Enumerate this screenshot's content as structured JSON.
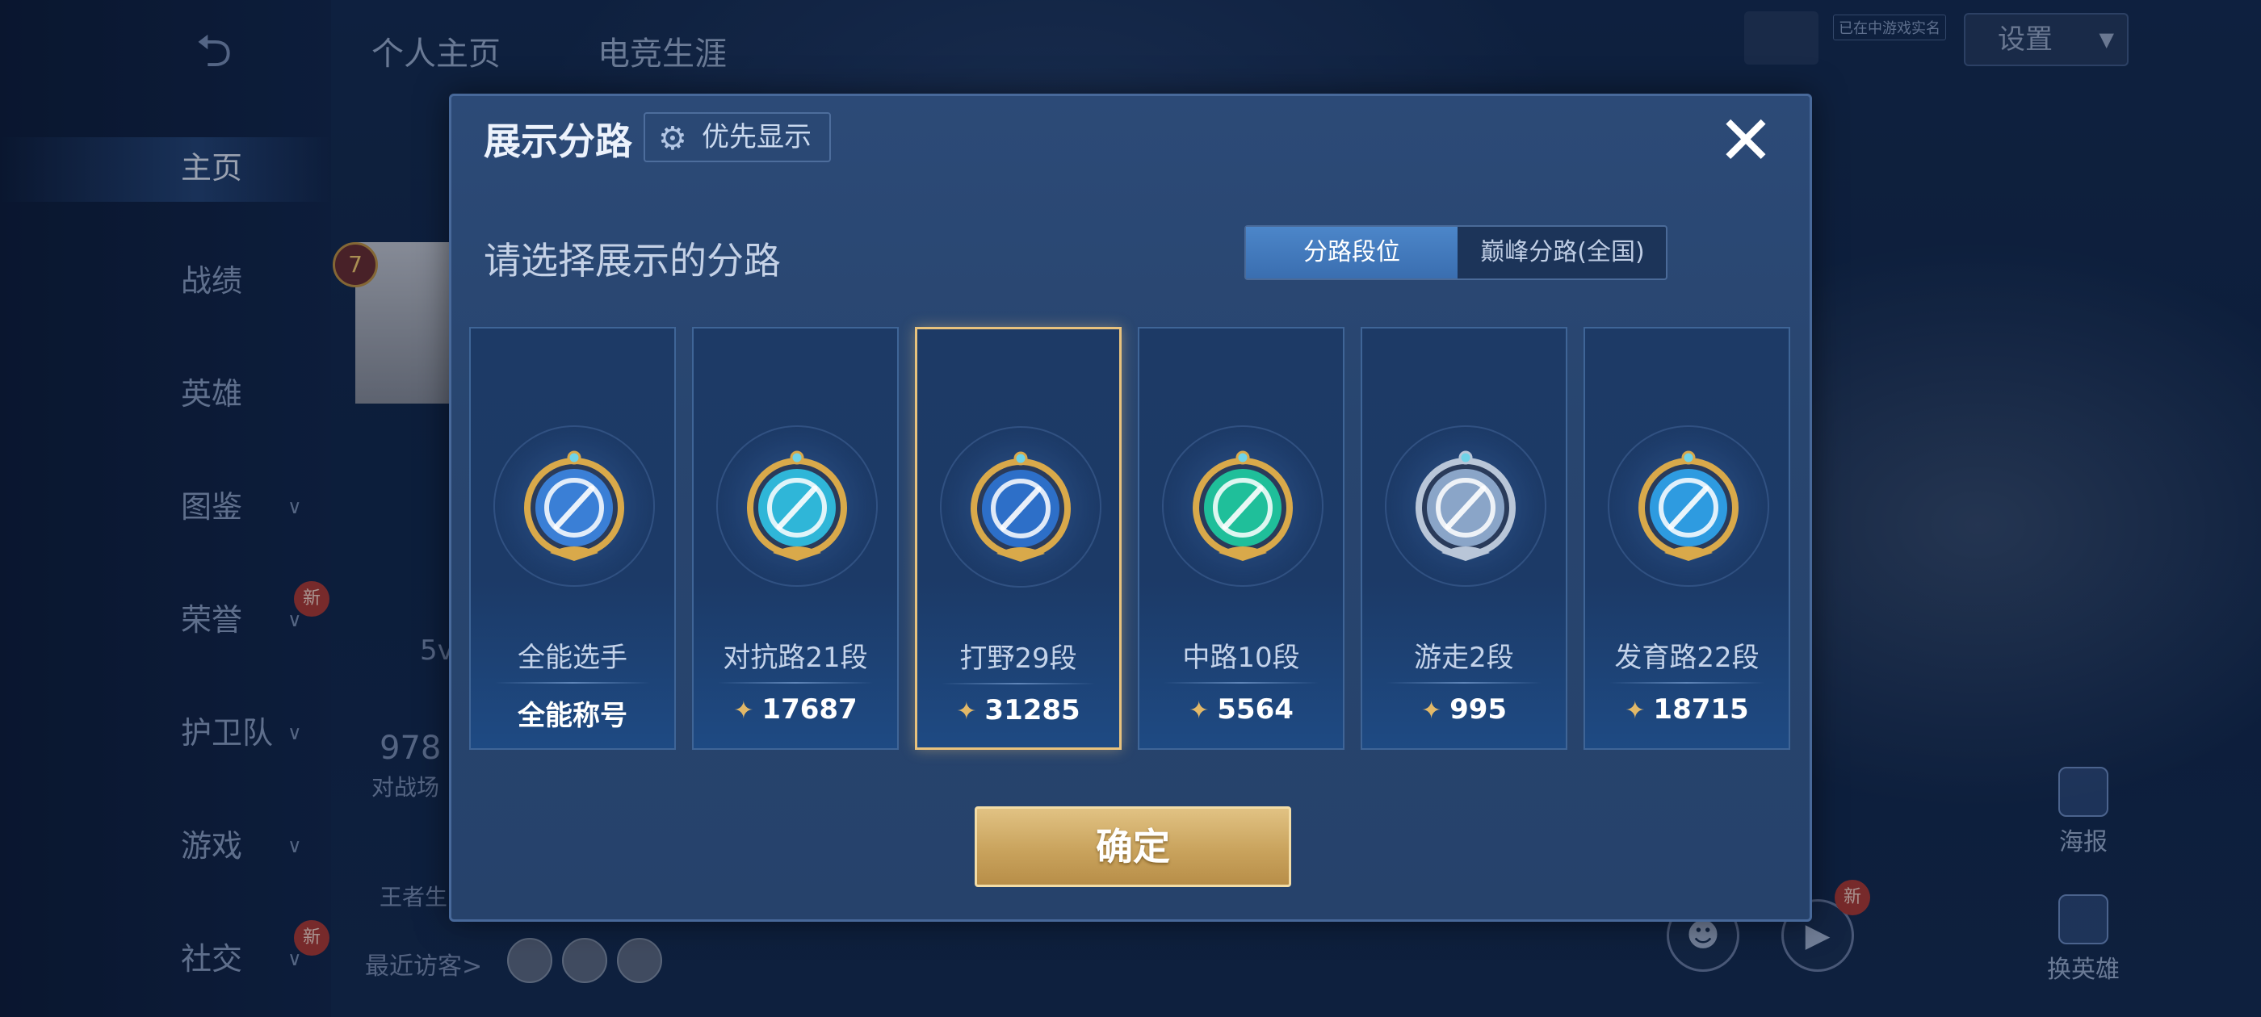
{
  "background": {
    "sidebar": {
      "items": [
        {
          "label": "主页",
          "new": false,
          "chevron": false
        },
        {
          "label": "战绩",
          "new": false,
          "chevron": false
        },
        {
          "label": "英雄",
          "new": false,
          "chevron": false
        },
        {
          "label": "图鉴",
          "new": false,
          "chevron": true
        },
        {
          "label": "荣誉",
          "new": true,
          "chevron": true
        },
        {
          "label": "护卫队",
          "new": false,
          "chevron": true
        },
        {
          "label": "游戏",
          "new": false,
          "chevron": true
        },
        {
          "label": "社交",
          "new": true,
          "chevron": true
        }
      ],
      "new_badge": "新"
    },
    "top_tabs": [
      "个人主页",
      "电竞生涯"
    ],
    "settings_label": "设置",
    "realname_tag": "已在中游戏实名",
    "rank_number": "7",
    "partial_texts": [
      "5v",
      "978",
      "对战场",
      "王者生"
    ],
    "recent_visitors": "最近访客>",
    "poster_label": "海报",
    "switch_hero_label": "换英雄",
    "new_badge_right": "新"
  },
  "modal": {
    "title": "展示分路",
    "priority_button": "优先显示",
    "section_title": "请选择展示的分路",
    "toggle": {
      "active": "分路段位",
      "inactive": "巅峰分路(全国)"
    },
    "lanes": [
      {
        "name": "全能选手",
        "value": "全能称号",
        "has_points": false,
        "emblem": "all-round-emblem-icon",
        "color": "#3a7fd6"
      },
      {
        "name": "对抗路21段",
        "value": "17687",
        "has_points": true,
        "emblem": "clash-lane-emblem-icon",
        "color": "#2fb6d8"
      },
      {
        "name": "打野29段",
        "value": "31285",
        "has_points": true,
        "emblem": "jungle-emblem-icon",
        "color": "#2d6fc8",
        "selected": true
      },
      {
        "name": "中路10段",
        "value": "5564",
        "has_points": true,
        "emblem": "mid-lane-emblem-icon",
        "color": "#1fbf9a"
      },
      {
        "name": "游走2段",
        "value": "995",
        "has_points": true,
        "emblem": "roam-emblem-icon",
        "color": "#8aa5c8"
      },
      {
        "name": "发育路22段",
        "value": "18715",
        "has_points": true,
        "emblem": "farm-lane-emblem-icon",
        "color": "#2e9be0"
      }
    ],
    "confirm_button": "确定"
  }
}
